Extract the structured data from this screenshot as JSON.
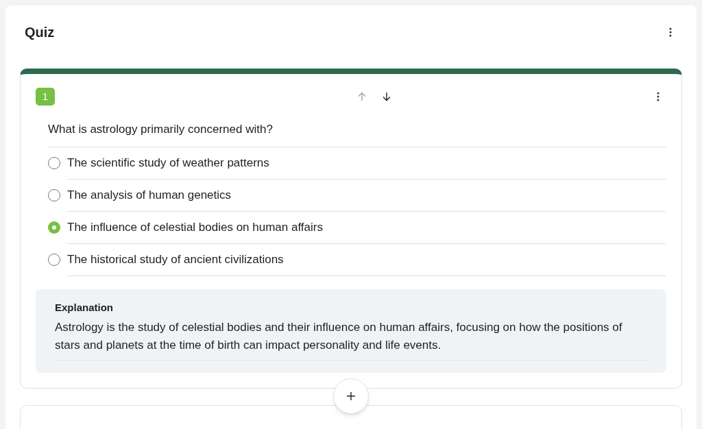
{
  "title": "Quiz",
  "question": {
    "number": "1",
    "move_up": {
      "disabled": true
    },
    "move_down": {
      "disabled": false
    },
    "text": "What is astrology primarily concerned with?",
    "options": [
      {
        "label": "The scientific study of weather patterns",
        "selected": false
      },
      {
        "label": "The analysis of human genetics",
        "selected": false
      },
      {
        "label": "The influence of celestial bodies on human affairs",
        "selected": true
      },
      {
        "label": "The historical study of ancient civilizations",
        "selected": false
      }
    ],
    "explanation": {
      "heading": "Explanation",
      "text": "Astrology is the study of celestial bodies and their influence on human affairs, focusing on how the positions of stars and planets at the time of birth can impact personality and life events."
    }
  }
}
